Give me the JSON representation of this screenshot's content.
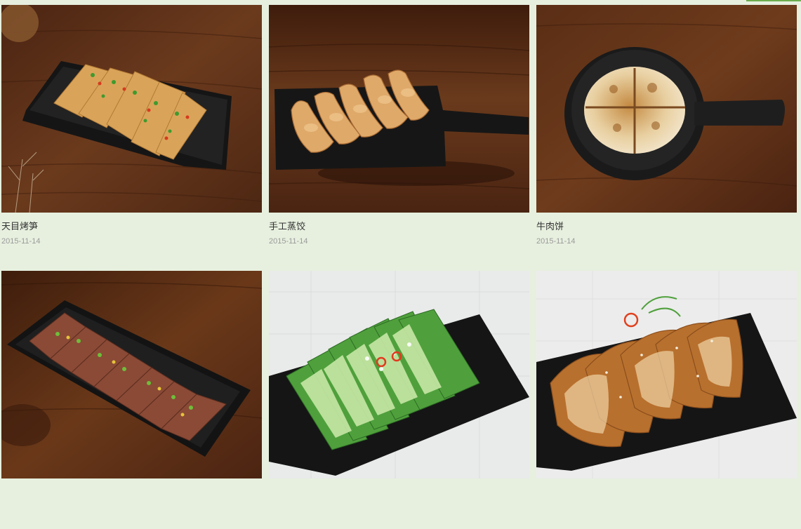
{
  "theme": {
    "page_background": "#e7f0df",
    "accent": "#6cad4f",
    "title_color": "#333333",
    "date_color": "#9a9a9a"
  },
  "gallery": {
    "items": [
      {
        "name": "天目烤笋",
        "date": "2015-11-14",
        "image": "bamboo-shoots-photo"
      },
      {
        "name": "手工蒸饺",
        "date": "2015-11-14",
        "image": "steamed-dumplings-photo"
      },
      {
        "name": "牛肉饼",
        "date": "2015-11-14",
        "image": "beef-pie-photo"
      },
      {
        "name": "",
        "date": "",
        "image": "sliced-beef-photo"
      },
      {
        "name": "",
        "date": "",
        "image": "smashed-cucumber-photo"
      },
      {
        "name": "",
        "date": "",
        "image": "pork-ear-photo"
      }
    ]
  }
}
